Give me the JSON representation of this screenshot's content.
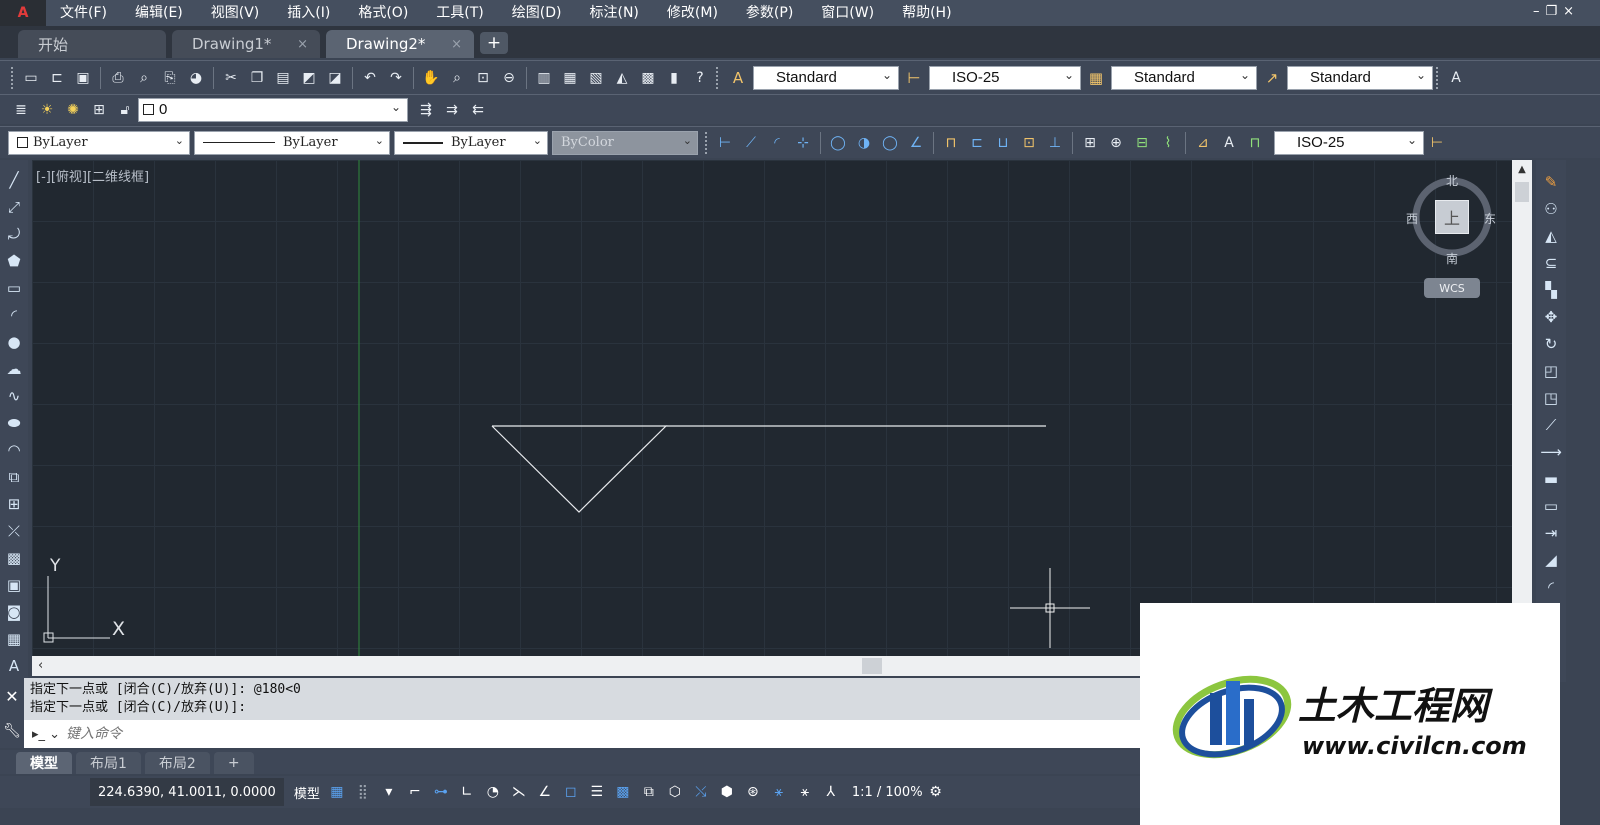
{
  "app": {
    "logo_glyph": "A"
  },
  "menu": [
    "文件(F)",
    "编辑(E)",
    "视图(V)",
    "插入(I)",
    "格式(O)",
    "工具(T)",
    "绘图(D)",
    "标注(N)",
    "修改(M)",
    "参数(P)",
    "窗口(W)",
    "帮助(H)"
  ],
  "window_controls": {
    "minimize": "–",
    "restore": "❐",
    "close": "×"
  },
  "tabs": [
    {
      "label": "开始"
    },
    {
      "label": "Drawing1*"
    },
    {
      "label": "Drawing2*"
    }
  ],
  "tab_close_glyph": "×",
  "new_tab_glyph": "+",
  "styles": {
    "text_style": "Standard",
    "dim_style": "ISO-25",
    "table_style": "Standard",
    "mleader_style": "Standard"
  },
  "layer": {
    "current": "0"
  },
  "properties": {
    "color": "ByLayer",
    "linetype": "ByLayer",
    "lineweight": "ByLayer",
    "plotstyle": "ByColor"
  },
  "dim_toolbar": {
    "style": "ISO-25"
  },
  "viewport": {
    "label": "[-][俯视][二维线框]"
  },
  "viewcube": {
    "north": "北",
    "south": "南",
    "east": "东",
    "west": "西",
    "face": "上",
    "wcs": "WCS"
  },
  "ucs": {
    "x": "X",
    "y": "Y"
  },
  "command": {
    "history": [
      "指定下一点或 [闭合(C)/放弃(U)]: @180<0",
      "指定下一点或 [闭合(C)/放弃(U)]:"
    ],
    "placeholder": "键入命令"
  },
  "layout_tabs": [
    "模型",
    "布局1",
    "布局2"
  ],
  "layout_add": "+",
  "status": {
    "coords": "224.6390, 41.0011, 0.0000",
    "model": "模型",
    "scale": "1:1 / 100%"
  },
  "watermark": {
    "brand": "土木工程网",
    "url": "www.civilcn.com"
  },
  "colors": {
    "canvas": "#212830",
    "accent": "#5aa2f0",
    "ucs_green": "#2f8a3c"
  }
}
